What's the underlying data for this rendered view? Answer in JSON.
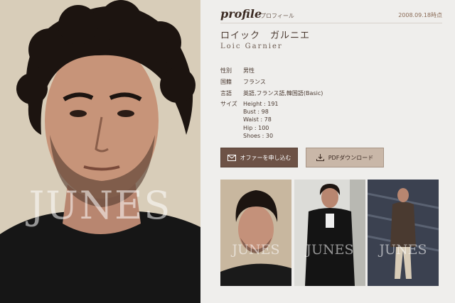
{
  "hero": {
    "watermark": "JUNES",
    "image": "portrait-photo"
  },
  "header": {
    "title": "profile",
    "subtitle": "プロフィール",
    "date": "2008.09.18時点"
  },
  "model": {
    "name_jp": "ロイック　ガルニエ",
    "name_en": "Loic Garnier"
  },
  "details": [
    {
      "label": "性別",
      "value": "男性"
    },
    {
      "label": "国籍",
      "value": "フランス"
    },
    {
      "label": "言語",
      "value": "英語,フランス語,韓国語(Basic)"
    },
    {
      "label": "サイズ",
      "value": "Height : 191"
    }
  ],
  "sizes": [
    "Bust : 98",
    "Waist : 78",
    "Hip : 100",
    "Shoes : 30"
  ],
  "buttons": {
    "offer": {
      "label": "オファーを申し込む",
      "icon": "envelope-icon"
    },
    "pdf": {
      "label": "PDFダウンロード",
      "icon": "download-icon"
    }
  },
  "thumbnails": [
    {
      "watermark": "JUNES"
    },
    {
      "watermark": "JUNES"
    },
    {
      "watermark": "JUNES"
    }
  ],
  "colors": {
    "accent": "#6d5246",
    "secondary": "#c9b7a8",
    "background": "#efeeec"
  }
}
